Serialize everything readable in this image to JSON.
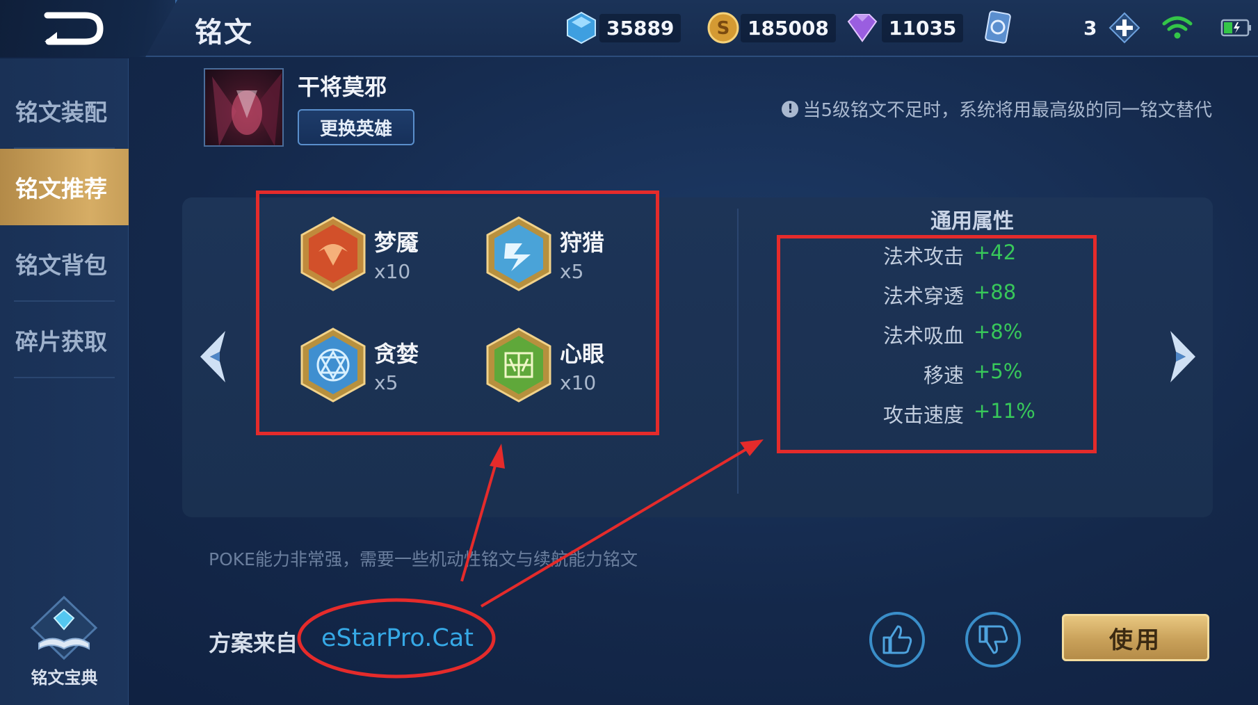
{
  "header": {
    "title": "铭文",
    "resources": [
      {
        "icon": "crystal-icon",
        "value": "35889"
      },
      {
        "icon": "gold-coin-icon",
        "value": "185008"
      },
      {
        "icon": "diamond-icon",
        "value": "11035"
      },
      {
        "icon": "card-icon",
        "value": "3"
      }
    ]
  },
  "sidebar": {
    "items": [
      {
        "label": "铭文装配"
      },
      {
        "label": "铭文推荐",
        "active": true
      },
      {
        "label": "铭文背包"
      },
      {
        "label": "碎片获取"
      }
    ],
    "codex_label": "铭文宝典"
  },
  "hero": {
    "name": "干将莫邪",
    "change_label": "更换英雄"
  },
  "notice": "当5级铭文不足时，系统将用最高级的同一铭文替代",
  "runes": [
    {
      "name": "梦魇",
      "count": "x10",
      "color": "#d2502a"
    },
    {
      "name": "狩猎",
      "count": "x5",
      "color": "#4aa3d8"
    },
    {
      "name": "贪婪",
      "count": "x5",
      "color": "#3f8fd0"
    },
    {
      "name": "心眼",
      "count": "x10",
      "color": "#5fa83a"
    }
  ],
  "stats": {
    "title": "通用属性",
    "rows": [
      {
        "label": "法术攻击",
        "value": "+42"
      },
      {
        "label": "法术穿透",
        "value": "+88"
      },
      {
        "label": "法术吸血",
        "value": "+8%"
      },
      {
        "label": "移速",
        "value": "+5%"
      },
      {
        "label": "攻击速度",
        "value": "+11%"
      }
    ]
  },
  "description": "POKE能力非常强，需要一些机动性铭文与续航能力铭文",
  "source": {
    "label": "方案来自",
    "value": "eStarPro.Cat"
  },
  "actions": {
    "use_label": "使用"
  },
  "colors": {
    "accent_green": "#38c85a",
    "annotation_red": "#e52b2b",
    "link_blue": "#36a9e6",
    "gold": "#c9a15a"
  }
}
